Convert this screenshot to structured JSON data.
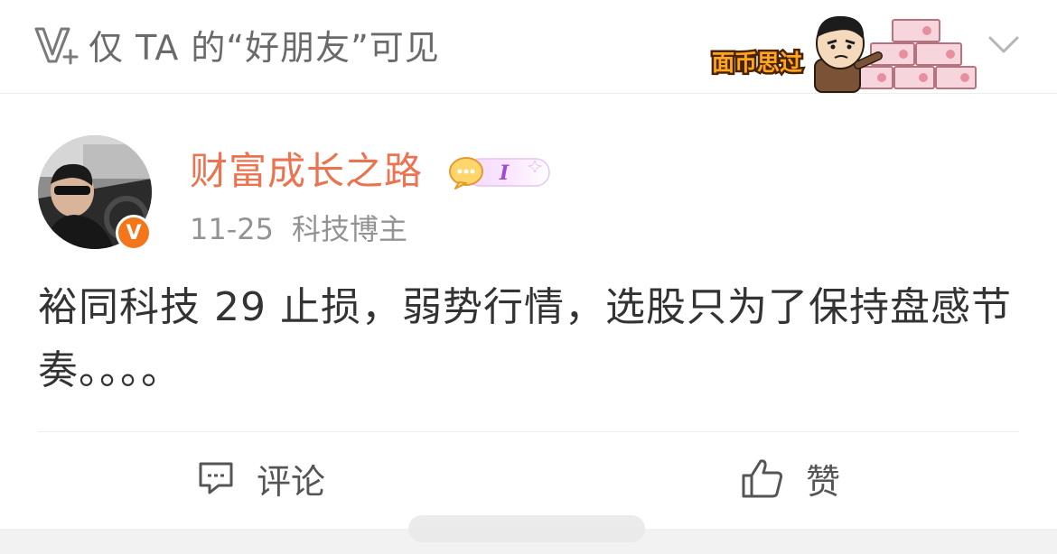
{
  "visibility": {
    "text": "仅 TA 的“好朋友”可见",
    "icon": "visibility-v-plus-icon"
  },
  "sticker": {
    "text": "面币思过",
    "icon": "sticker-face-wall-of-money"
  },
  "author": {
    "name": "财富成长之路",
    "date": "11-25",
    "role": "科技博主",
    "verified_label": "V",
    "member_badge_label": "I",
    "name_color": "#eb7350"
  },
  "post": {
    "text": "裕同科技 29 止损，弱势行情，选股只为了保持盘感节奏。。。。"
  },
  "actions": {
    "comment_label": "评论",
    "like_label": "赞"
  },
  "colors": {
    "accent": "#eb7350",
    "verified": "#f5761a",
    "text_primary": "#333333",
    "text_secondary": "#939393"
  }
}
